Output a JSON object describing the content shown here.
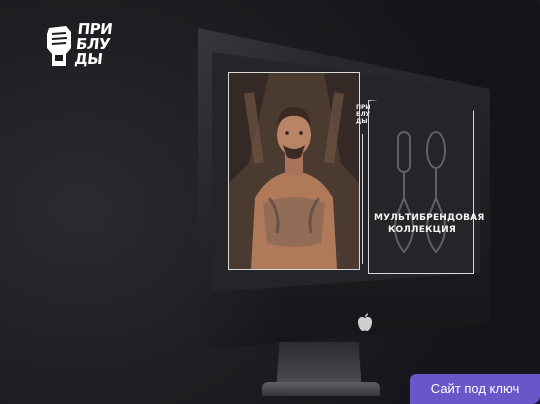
{
  "logo": {
    "lines": [
      "ПРИ",
      "БЛУ",
      "ДЫ"
    ],
    "icon": "fist-icon"
  },
  "screen": {
    "site_logo_lines": [
      "ПРИ",
      "БЛУ",
      "ДЫ"
    ],
    "collection_title": [
      "МУЛЬТИБРЕНДОВАЯ",
      "КОЛЛЕКЦИЯ"
    ],
    "hero_image": "tattooed-man-photo",
    "product_image": "earrings-illustration"
  },
  "device": {
    "brand_icon": "apple-icon"
  },
  "badge": {
    "label": "Сайт под ключ"
  },
  "colors": {
    "background": "#1b1c1f",
    "badge": "#6a55c9",
    "text": "#ffffff"
  }
}
